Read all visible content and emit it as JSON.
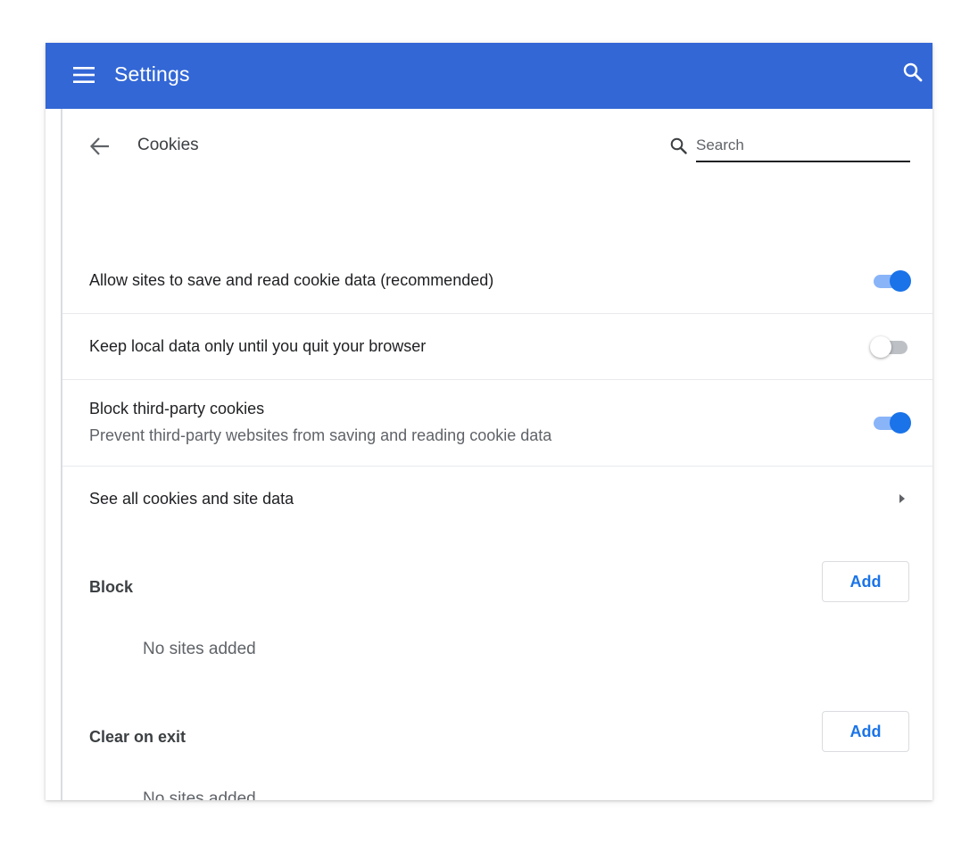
{
  "app": {
    "title": "Settings"
  },
  "page": {
    "title": "Cookies",
    "search": {
      "placeholder": "Search",
      "value": ""
    }
  },
  "settings": [
    {
      "label": "Allow sites to save and read cookie data (recommended)",
      "enabled": true
    },
    {
      "label": "Keep local data only until you quit your browser",
      "enabled": false
    },
    {
      "label": "Block third-party cookies",
      "sublabel": "Prevent third-party websites from saving and reading cookie data",
      "enabled": true
    }
  ],
  "see_all": {
    "label": "See all cookies and site data"
  },
  "sections": {
    "block": {
      "title": "Block",
      "button_label": "Add",
      "empty_text": "No sites added"
    },
    "clear_on_exit": {
      "title": "Clear on exit",
      "button_label": "Add",
      "empty_text": "No sites added"
    }
  },
  "icons": {
    "menu": "menu-icon",
    "top_search": "search-icon",
    "back": "arrow-back-icon",
    "search_field": "search-icon",
    "chevron": "chevron-right-icon"
  },
  "colors": {
    "header_bg": "#3367d6",
    "accent": "#1a73e8",
    "toggle_track_on": "#8ab4f8",
    "toggle_track_off": "#bdc1c6",
    "divider": "#e8eaed"
  }
}
